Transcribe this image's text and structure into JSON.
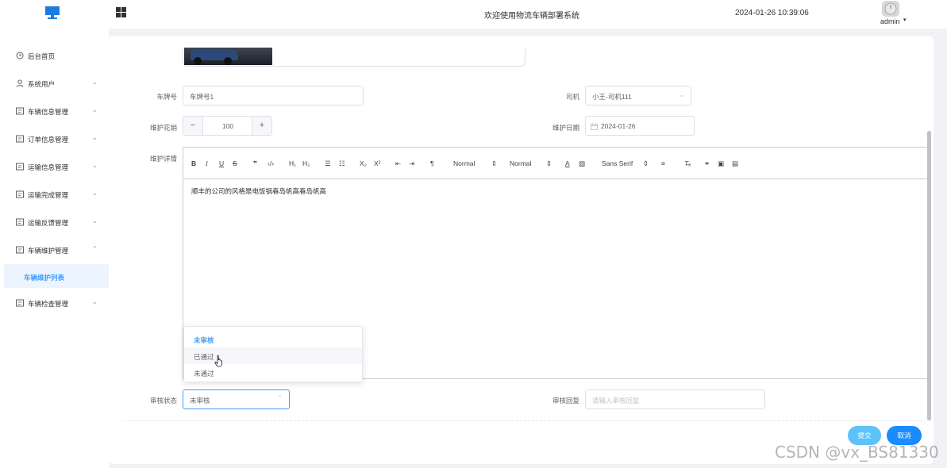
{
  "header": {
    "title": "欢迎使用物流车辆部署系统",
    "datetime": "2024-01-26 10:39:06",
    "user": "admin",
    "accent": "#1e7be0"
  },
  "sidebar": {
    "items": [
      {
        "label": "后台首页",
        "icon": "clock-icon",
        "expandable": false
      },
      {
        "label": "系统用户",
        "icon": "user-icon",
        "expandable": true
      },
      {
        "label": "车辆信息管理",
        "icon": "list-icon",
        "expandable": true
      },
      {
        "label": "订单信息管理",
        "icon": "list-icon",
        "expandable": true
      },
      {
        "label": "运输信息管理",
        "icon": "list-icon",
        "expandable": true
      },
      {
        "label": "运输完成管理",
        "icon": "list-icon",
        "expandable": true
      },
      {
        "label": "运输反馈管理",
        "icon": "list-icon",
        "expandable": true
      },
      {
        "label": "车辆维护管理",
        "icon": "list-icon",
        "expandable": true,
        "expanded": true
      },
      {
        "label": "车辆检查管理",
        "icon": "list-icon",
        "expandable": true
      }
    ],
    "active_sub": "车辆维护列表"
  },
  "form": {
    "plate_label": "车牌号",
    "plate_value": "车牌号1",
    "driver_label": "司机",
    "driver_value": "小王-司机111",
    "cost_label": "维护花销",
    "cost_value": "100",
    "date_label": "维护日期",
    "date_value": "2024-01-26",
    "detail_label": "维护详情",
    "detail_text": "顺丰的公司的风格是电饭锅春岛帆高春岛帆高",
    "status_label": "审核状态",
    "status_value": "未审核",
    "reply_label": "审核回复",
    "reply_placeholder": "请输入审核回复"
  },
  "editor_toolbar": {
    "header_select": "Normal",
    "size_select": "Normal",
    "font_select": "Sans Serif"
  },
  "dropdown": {
    "options": [
      "未审核",
      "已通过",
      "未通过"
    ],
    "selected": "未审核",
    "hovered": "已通过"
  },
  "buttons": {
    "submit": "提交",
    "cancel": "取消"
  },
  "watermark": "CSDN @vx_BS81330"
}
